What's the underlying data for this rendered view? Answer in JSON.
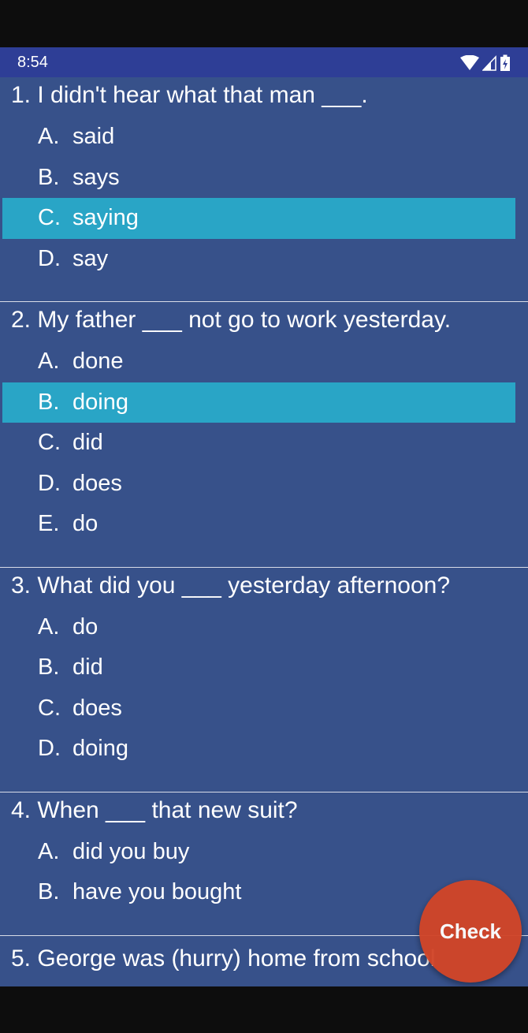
{
  "status": {
    "time": "8:54"
  },
  "questions": [
    {
      "text": "1. I didn't hear what that man ___.",
      "selected": 2,
      "options": [
        {
          "letter": "A.",
          "text": "said"
        },
        {
          "letter": "B.",
          "text": "says"
        },
        {
          "letter": "C.",
          "text": "saying"
        },
        {
          "letter": "D.",
          "text": "say"
        }
      ]
    },
    {
      "text": "2. My father ___ not go to work yesterday.",
      "selected": 1,
      "options": [
        {
          "letter": "A.",
          "text": "done"
        },
        {
          "letter": "B.",
          "text": "doing"
        },
        {
          "letter": "C.",
          "text": "did"
        },
        {
          "letter": "D.",
          "text": "does"
        },
        {
          "letter": "E.",
          "text": "do"
        }
      ]
    },
    {
      "text": "3. What did you ___ yesterday afternoon?",
      "selected": null,
      "options": [
        {
          "letter": "A.",
          "text": "do"
        },
        {
          "letter": "B.",
          "text": "did"
        },
        {
          "letter": "C.",
          "text": "does"
        },
        {
          "letter": "D.",
          "text": "doing"
        }
      ]
    },
    {
      "text": "4. When ___ that new suit?",
      "selected": null,
      "options": [
        {
          "letter": "A.",
          "text": "did you buy"
        },
        {
          "letter": "B.",
          "text": "have you bought"
        }
      ]
    },
    {
      "text": "5. George was (hurry) home from school",
      "selected": null,
      "options": []
    }
  ],
  "check_button": {
    "label": "Check"
  },
  "colors": {
    "selected": "#29a5c6",
    "background": "#37518a",
    "fab": "#d24528",
    "statusbar": "#2e3e96"
  }
}
